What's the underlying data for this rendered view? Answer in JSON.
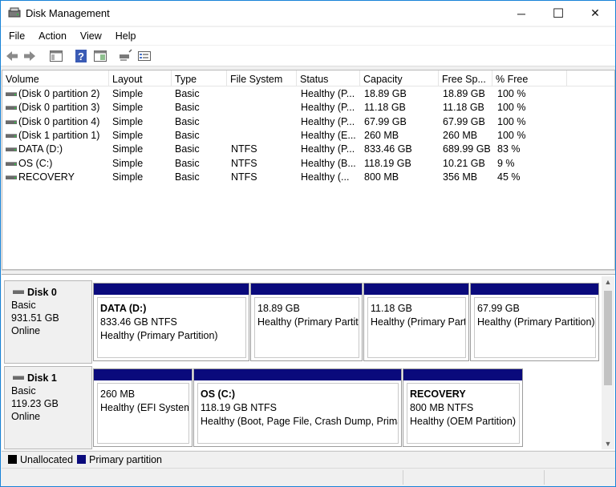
{
  "window": {
    "title": "Disk Management"
  },
  "titlebar": {
    "min_glyph": "─",
    "max_glyph": "☐",
    "close_glyph": "✕"
  },
  "menu": [
    "File",
    "Action",
    "View",
    "Help"
  ],
  "toolbar": {
    "icons": [
      "back-icon",
      "forward-icon",
      "console-tree-icon",
      "help-icon",
      "properties-icon",
      "connect-icon",
      "rescan-icon"
    ]
  },
  "volume_table": {
    "columns": [
      "Volume",
      "Layout",
      "Type",
      "File System",
      "Status",
      "Capacity",
      "Free Sp...",
      "% Free"
    ],
    "rows": [
      [
        "(Disk 0 partition 2)",
        "Simple",
        "Basic",
        "",
        "Healthy (P...",
        "18.89 GB",
        "18.89 GB",
        "100 %"
      ],
      [
        "(Disk 0 partition 3)",
        "Simple",
        "Basic",
        "",
        "Healthy (P...",
        "11.18 GB",
        "11.18 GB",
        "100 %"
      ],
      [
        "(Disk 0 partition 4)",
        "Simple",
        "Basic",
        "",
        "Healthy (P...",
        "67.99 GB",
        "67.99 GB",
        "100 %"
      ],
      [
        "(Disk 1 partition 1)",
        "Simple",
        "Basic",
        "",
        "Healthy (E...",
        "260 MB",
        "260 MB",
        "100 %"
      ],
      [
        "DATA (D:)",
        "Simple",
        "Basic",
        "NTFS",
        "Healthy (P...",
        "833.46 GB",
        "689.99 GB",
        "83 %"
      ],
      [
        "OS (C:)",
        "Simple",
        "Basic",
        "NTFS",
        "Healthy (B...",
        "118.19 GB",
        "10.21 GB",
        "9 %"
      ],
      [
        "RECOVERY",
        "Simple",
        "Basic",
        "NTFS",
        "Healthy (...",
        "800 MB",
        "356 MB",
        "45 %"
      ]
    ]
  },
  "disks": [
    {
      "name": "Disk 0",
      "type": "Basic",
      "size": "931.51 GB",
      "state": "Online",
      "partitions": [
        {
          "name": "DATA  (D:)",
          "size": "833.46 GB NTFS",
          "status": "Healthy (Primary Partition)"
        },
        {
          "name": "",
          "size": "18.89 GB",
          "status": "Healthy (Primary Partiti"
        },
        {
          "name": "",
          "size": "11.18 GB",
          "status": "Healthy (Primary Parti"
        },
        {
          "name": "",
          "size": "67.99 GB",
          "status": "Healthy (Primary Partition)"
        }
      ]
    },
    {
      "name": "Disk 1",
      "type": "Basic",
      "size": "119.23 GB",
      "state": "Online",
      "partitions": [
        {
          "name": "",
          "size": "260 MB",
          "status": "Healthy (EFI System"
        },
        {
          "name": "OS  (C:)",
          "size": "118.19 GB NTFS",
          "status": "Healthy (Boot, Page File, Crash Dump, Primar"
        },
        {
          "name": "RECOVERY",
          "size": "800 MB NTFS",
          "status": "Healthy (OEM Partition)"
        }
      ]
    }
  ],
  "legend": [
    {
      "label": "Unallocated",
      "color": "#000000"
    },
    {
      "label": "Primary partition",
      "color": "#0a0a7c"
    }
  ],
  "colors": {
    "partition_bar": "#0a0a7c",
    "title_accent": "#1883d7"
  }
}
